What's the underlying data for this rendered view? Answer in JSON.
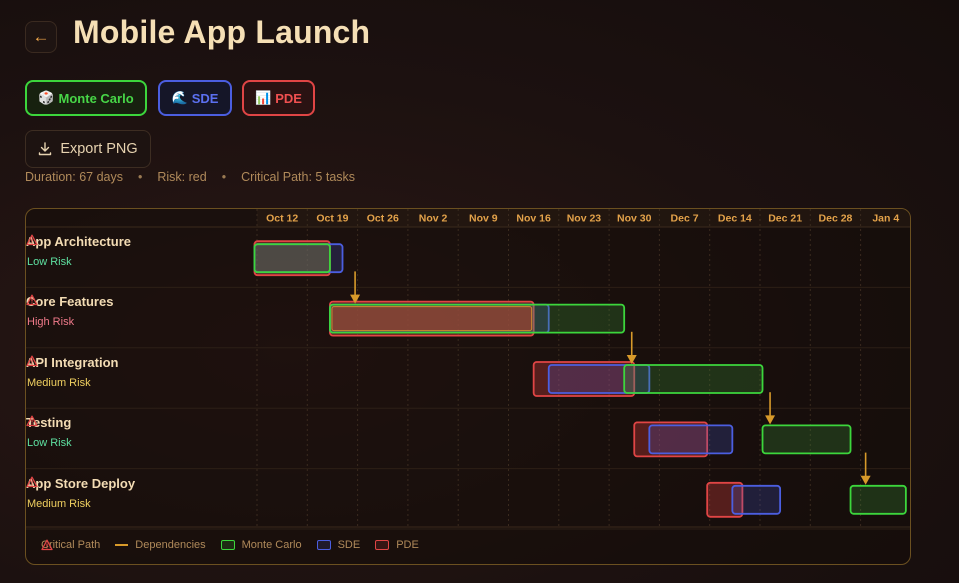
{
  "header": {
    "back_icon": "arrow-left-icon",
    "title": "Mobile App Launch"
  },
  "methods": [
    {
      "label": "Monte Carlo",
      "icon": "🎲",
      "color": "#47d647"
    },
    {
      "label": "SDE",
      "icon": "🌊",
      "color": "#5b70f0"
    },
    {
      "label": "PDE",
      "icon": "📊",
      "color": "#f05050"
    }
  ],
  "export": {
    "label": "Export PNG",
    "icon": "download-icon"
  },
  "summary": {
    "duration": "Duration: 67 days",
    "risk": "Risk: red",
    "critical_path": "Critical Path: 5 tasks"
  },
  "chart_data": {
    "type": "gantt",
    "dates": [
      "Oct 12",
      "Oct 19",
      "Oct 26",
      "Nov 2",
      "Nov 9",
      "Nov 16",
      "Nov 23",
      "Nov 30",
      "Dec 7",
      "Dec 14",
      "Dec 21",
      "Dec 28",
      "Jan 4"
    ],
    "start_date": "Oct 12",
    "tasks": [
      {
        "name": "App Architecture",
        "risk": "Low Risk",
        "risk_color": "#5ee0a0",
        "critical": true,
        "mc": [
          -0.05,
          1.45
        ],
        "sde": [
          -0.05,
          1.7
        ],
        "pde": [
          -0.05,
          1.45
        ]
      },
      {
        "name": "Core Features",
        "risk": "High Risk",
        "risk_color": "#f07a8a",
        "critical": true,
        "mc": [
          1.45,
          7.3
        ],
        "sde": [
          1.45,
          5.8
        ],
        "pde": [
          1.45,
          5.5
        ]
      },
      {
        "name": "API Integration",
        "risk": "Medium Risk",
        "risk_color": "#f0d060",
        "critical": true,
        "mc": [
          7.3,
          10.05
        ],
        "sde": [
          5.8,
          7.8
        ],
        "pde": [
          5.5,
          7.5
        ]
      },
      {
        "name": "Testing",
        "risk": "Low Risk",
        "risk_color": "#5ee0a0",
        "critical": true,
        "mc": [
          10.05,
          11.8
        ],
        "sde": [
          7.8,
          9.45
        ],
        "pde": [
          7.5,
          8.95
        ]
      },
      {
        "name": "App Store Deploy",
        "risk": "Medium Risk",
        "risk_color": "#f0d060",
        "critical": true,
        "mc": [
          11.8,
          12.9
        ],
        "sde": [
          9.45,
          10.4
        ],
        "pde": [
          8.95,
          9.65
        ]
      }
    ],
    "dependencies": [
      [
        0,
        1
      ],
      [
        1,
        2
      ],
      [
        2,
        3
      ],
      [
        3,
        4
      ]
    ]
  },
  "legend": {
    "critical": "Critical Path",
    "dependencies": "Dependencies",
    "mc": "Monte Carlo",
    "sde": "SDE",
    "pde": "PDE"
  },
  "colors": {
    "mc": "#3cd63c",
    "sde": "#4b5ee0",
    "pde": "#e04545",
    "dependency": "#d89a2a",
    "critical": "#e04545"
  }
}
